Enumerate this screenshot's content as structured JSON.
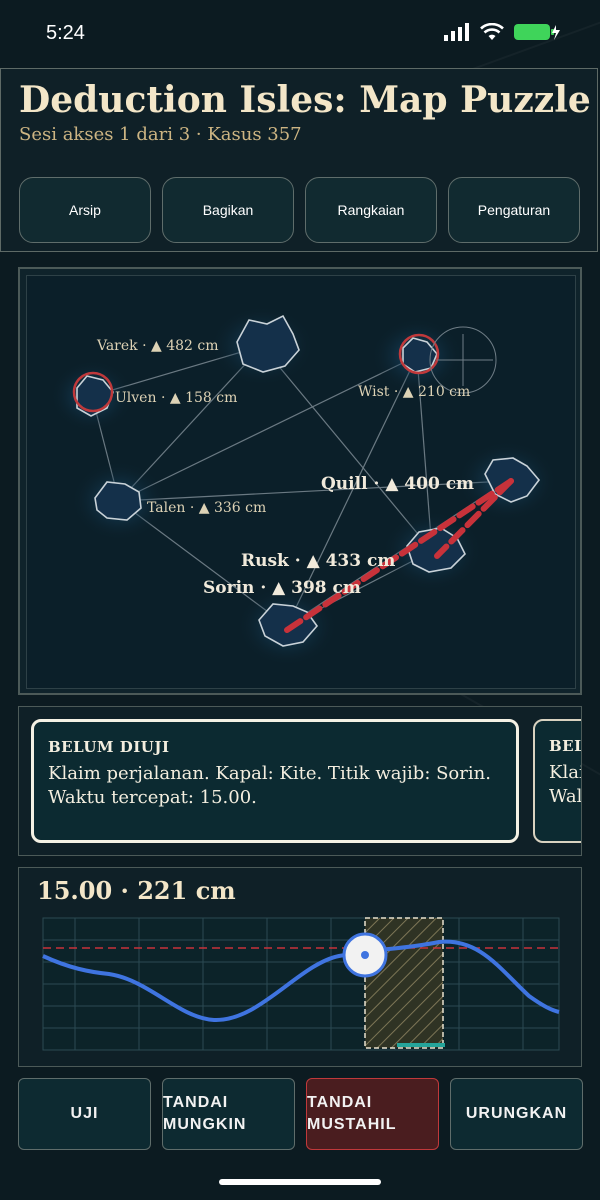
{
  "status_bar": {
    "time": "5:24",
    "icons": [
      "signal-icon",
      "wifi-icon",
      "battery-charging-icon"
    ]
  },
  "header": {
    "title": "Deduction Isles: Map Puzzle",
    "subtitle": "Sesi akses 1 dari 3 · Kasus 357"
  },
  "toolbar": {
    "buttons": [
      "Arsip",
      "Bagikan",
      "Rangkaian",
      "Pengaturan"
    ]
  },
  "map": {
    "islands": [
      {
        "name": "Varek",
        "elevation": "▲ 482 cm",
        "flagged": false
      },
      {
        "name": "Ulven",
        "elevation": "▲ 158 cm",
        "flagged": true
      },
      {
        "name": "Wist",
        "elevation": "▲ 210 cm",
        "flagged": true
      },
      {
        "name": "Quill",
        "elevation": "▲ 400 cm",
        "flagged": false
      },
      {
        "name": "Talen",
        "elevation": "▲ 336 cm",
        "flagged": false
      },
      {
        "name": "Rusk",
        "elevation": "▲ 433 cm",
        "flagged": false
      },
      {
        "name": "Sorin",
        "elevation": "▲ 398 cm",
        "flagged": false
      }
    ],
    "separator": "·"
  },
  "clues": [
    {
      "status": "BELUM DIUJI",
      "text": "Klaim perjalanan. Kapal: Kite. Titik wajib: Sorin.\nWaktu tercepat: 15.00."
    },
    {
      "status": "BELU",
      "text": "Klai\nWal"
    }
  ],
  "profile": {
    "time": "15.00",
    "separator": "·",
    "depth": "221 cm"
  },
  "actions": [
    "UJI",
    "TANDAI\nMUNGKIN",
    "TANDAI\nMUSTAHIL",
    "URUNGKAN"
  ],
  "colors": {
    "accent_red": "#c0393b",
    "route_red": "#c8323a",
    "curve_blue": "#3f74e0",
    "cream": "#f3e6c8"
  }
}
